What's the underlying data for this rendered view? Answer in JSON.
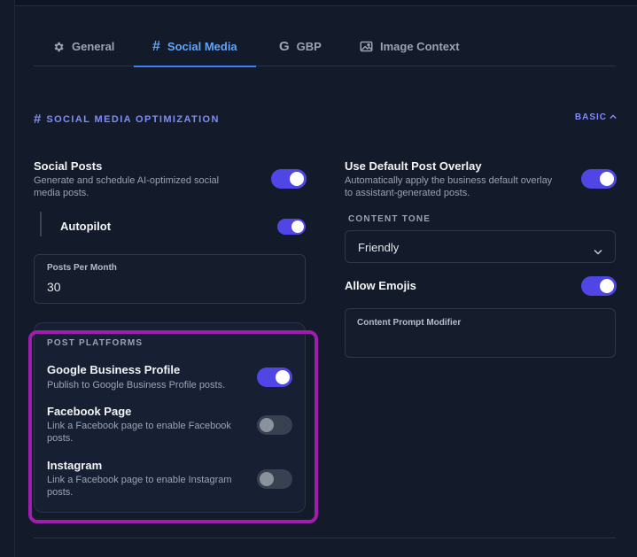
{
  "tabs": [
    {
      "label": "General",
      "icon": "gear-icon"
    },
    {
      "label": "Social Media",
      "icon": "hash-icon"
    },
    {
      "label": "GBP",
      "icon": "google-icon"
    },
    {
      "label": "Image Context",
      "icon": "image-icon"
    }
  ],
  "active_tab": "Social Media",
  "section": {
    "title": "SOCIAL MEDIA OPTIMIZATION",
    "mode_label": "BASIC"
  },
  "social_posts": {
    "label": "Social Posts",
    "description_line1": "Generate and schedule AI-optimized social",
    "description_line2": "media posts.",
    "enabled": true
  },
  "autopilot": {
    "label": "Autopilot",
    "enabled": true
  },
  "posts_per_month": {
    "label": "Posts Per Month",
    "value": "30"
  },
  "post_platforms": {
    "title": "POST PLATFORMS",
    "items": [
      {
        "label": "Google Business Profile",
        "description_line1": "Publish to Google Business Profile posts.",
        "description_line2": "",
        "enabled": true
      },
      {
        "label": "Facebook Page",
        "description_line1": "Link a Facebook page to enable Facebook",
        "description_line2": "posts.",
        "enabled": false
      },
      {
        "label": "Instagram",
        "description_line1": "Link a Facebook page to enable Instagram",
        "description_line2": "posts.",
        "enabled": false
      }
    ]
  },
  "default_overlay": {
    "label": "Use Default Post Overlay",
    "description_line1": "Automatically apply the business default overlay",
    "description_line2": "to assistant-generated posts.",
    "enabled": true
  },
  "content_tone": {
    "label": "CONTENT TONE",
    "value": "Friendly"
  },
  "allow_emojis": {
    "label": "Allow Emojis",
    "enabled": true
  },
  "content_prompt_modifier": {
    "label": "Content Prompt Modifier",
    "value": ""
  },
  "colors": {
    "background": "#131a2a",
    "accent": "#4f46e5",
    "active_tab": "#60a5fa",
    "section_title": "#818cf8",
    "highlight_outline": "#a21caf"
  }
}
